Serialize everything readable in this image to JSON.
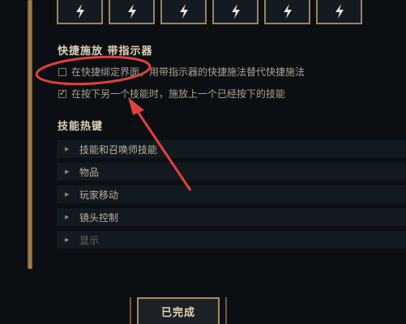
{
  "hotkey_slots": [
    {
      "icon": "lightning-icon"
    },
    {
      "icon": "lightning-icon"
    },
    {
      "icon": "lightning-icon"
    },
    {
      "icon": "lightning-icon"
    },
    {
      "icon": "lightning-icon"
    },
    {
      "icon": "lightning-icon"
    }
  ],
  "quickcast": {
    "title": "快捷施放 带指示器",
    "option1_label": "在快捷绑定界面，用带指示器的快捷施法替代快捷施法",
    "option1_checked": false,
    "option2_label": "在按下另一个技能时，施放上一个已经按下的技能",
    "option2_checked": true
  },
  "ability_hotkeys": {
    "title": "技能热键",
    "items": [
      {
        "label": "技能和召唤师技能"
      },
      {
        "label": "物品"
      },
      {
        "label": "玩家移动"
      },
      {
        "label": "镜头控制"
      },
      {
        "label": "显示"
      }
    ]
  },
  "footer": {
    "done_label": "已完成"
  },
  "colors": {
    "accent_gold": "#a88e57",
    "annotation_red": "#e0413a",
    "background": "#0b0f14"
  }
}
